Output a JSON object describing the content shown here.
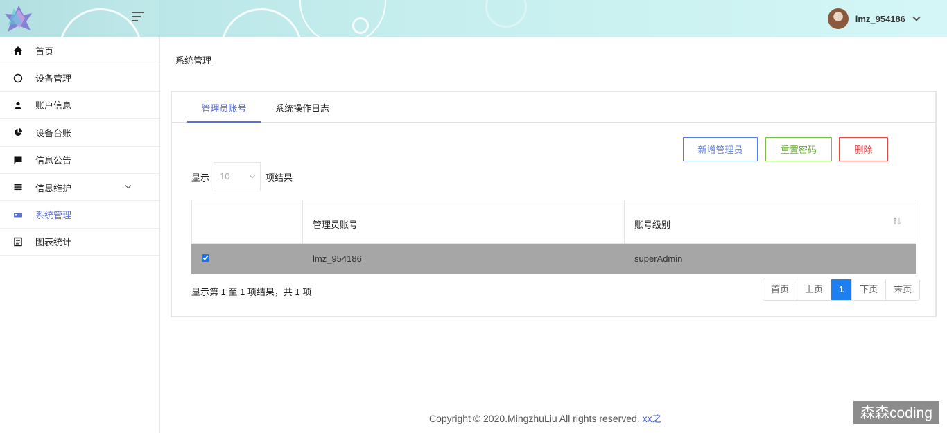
{
  "header": {
    "username": "lmz_954186"
  },
  "sidebar": {
    "items": [
      {
        "label": "首页",
        "icon": "home-icon"
      },
      {
        "label": "设备管理",
        "icon": "circle-icon"
      },
      {
        "label": "账户信息",
        "icon": "user-icon"
      },
      {
        "label": "设备台账",
        "icon": "pie-chart-icon"
      },
      {
        "label": "信息公告",
        "icon": "message-icon"
      },
      {
        "label": "信息维护",
        "icon": "list-icon"
      },
      {
        "label": "系统管理",
        "icon": "id-card-icon"
      },
      {
        "label": "图表统计",
        "icon": "document-icon"
      }
    ]
  },
  "main": {
    "title": "系统管理",
    "tabs": [
      {
        "label": "管理员账号"
      },
      {
        "label": "系统操作日志"
      }
    ],
    "buttons": {
      "add": "新增管理员",
      "reset": "重置密码",
      "delete": "删除"
    },
    "length": {
      "prefix": "显示",
      "value": "10",
      "suffix": "项结果"
    },
    "table": {
      "headers": [
        "",
        "管理员账号",
        "账号级别"
      ],
      "rows": [
        {
          "checked": true,
          "account": "lmz_954186",
          "level": "superAdmin"
        }
      ]
    },
    "info": "显示第 1 至 1 项结果，共 1 项",
    "pager": {
      "first": "首页",
      "prev": "上页",
      "current": "1",
      "next": "下页",
      "last": "末页"
    }
  },
  "footer": {
    "text": "Copyright © 2020.MingzhuLiu All rights reserved. ",
    "link": "xx之"
  },
  "watermark": "森森coding",
  "colors": {
    "accent": "#5a6fd6",
    "primary_btn": "#5b7de6",
    "success_btn": "#7cbb44",
    "danger_btn": "#e04848",
    "pager_active": "#1e7ff0",
    "selected_row": "#a6a6a6"
  }
}
